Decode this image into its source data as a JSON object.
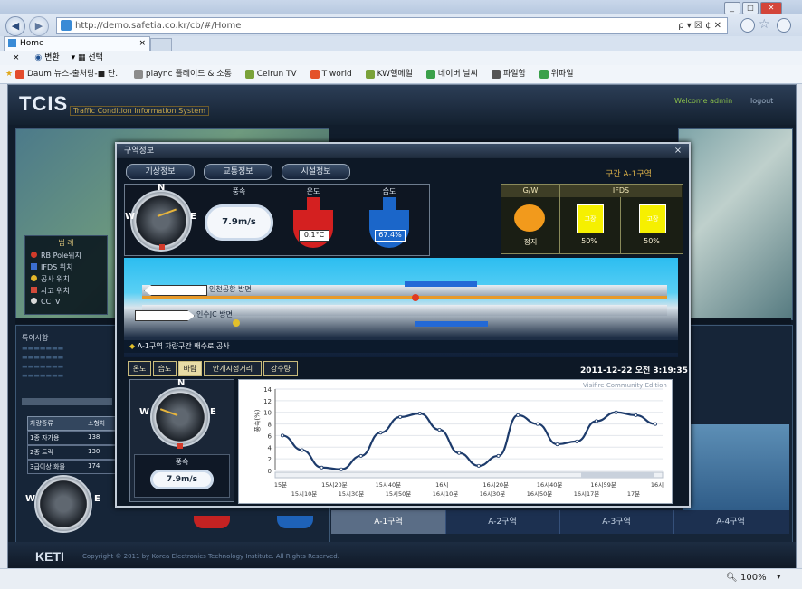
{
  "browser": {
    "url": "http://demo.safetia.co.kr/cb/#/Home",
    "search_hint": "ρ ▾ ☒ ¢ ✕",
    "tab_label": "Home",
    "cmd_items": [
      "×",
      "변환",
      "선택"
    ],
    "favorites": [
      "Daum 뉴스-출처랑-■ 단..",
      "plaync 플레이드 & 소통",
      "Celrun TV",
      "T world",
      "KW헬메일",
      "네이버 날씨",
      "파일함",
      "위파일"
    ],
    "zoom": "100%"
  },
  "app": {
    "logo": "TCIS",
    "logo_sub": "Traffic Condition Information System",
    "welcome": "Welcome admin",
    "logout": "logout",
    "legend_title": "범 례",
    "legend_items": [
      "RB Pole위치",
      "IFDS 위치",
      "공사 위치",
      "사고 위치",
      "CCTV"
    ],
    "legend_colors": [
      "#d03b2a",
      "#3c6fd0",
      "#e2b62a",
      "#d04a3a",
      "#d8d8d8"
    ],
    "lower_left_title": "특이사항",
    "table_header": [
      "차량종류",
      "소형차"
    ],
    "table_rows": [
      [
        "1종 자가용",
        "138"
      ],
      [
        "2종 트럭",
        "130"
      ],
      [
        "3급이상 화물",
        "174"
      ]
    ],
    "zones": [
      "A-1구역",
      "A-2구역",
      "A-3구역",
      "A-4구역"
    ],
    "footer_logo": "KETI",
    "copyright": "Copyright © 2011 by Korea Electronics Technology Institute. All Rights Reserved."
  },
  "modal": {
    "title": "구역정보",
    "close": "×",
    "tabs": [
      "기상정보",
      "교통정보",
      "시설정보"
    ],
    "section": "구간 A-1구역",
    "compass": {
      "n": "N",
      "w": "W",
      "e": "E"
    },
    "wind_label": "풍속",
    "wind_value": "7.9m/s",
    "temp_label": "온도",
    "temp_value": "0.1°C",
    "humid_label": "습도",
    "humid_value": "67.4%",
    "gw_header": "G/W",
    "ifds_header": "IFDS",
    "gw_status": "정지",
    "ifds1": "50%",
    "ifds2": "50%",
    "ifds_label1": "고장",
    "ifds_label2": "고장",
    "lane_top": "인천공항 방면",
    "lane_bottom": "인수JC 방면",
    "notice": "A-1구역 차량구간 배수로 공사",
    "sub_tabs": [
      "온도",
      "습도",
      "바람",
      "안개시정거리",
      "강수량"
    ],
    "datetime": "2011-12-22 오전 3:19:35",
    "small_wind_label": "풍속",
    "small_wind_value": "7.9m/s",
    "chart_watermark": "Visifire Community Edition"
  },
  "chart_data": {
    "type": "line",
    "ylabel": "풍속(%)",
    "ylim": [
      0,
      14
    ],
    "yticks": [
      0,
      2,
      4,
      6,
      8,
      10,
      12,
      14
    ],
    "x_labels_top": [
      "15분",
      "15시20분",
      "15시40분",
      "16시",
      "16시20분",
      "16시40분",
      "16시59분",
      "16시"
    ],
    "x_labels_bottom": [
      "15시10분",
      "15시30분",
      "15시50분",
      "16시10분",
      "16시30분",
      "16시50분",
      "16시17분",
      "17분"
    ],
    "series": [
      {
        "values": [
          6,
          3.5,
          0.5,
          0.2,
          2.5,
          6.5,
          9.2,
          9.8,
          7,
          3,
          0.8,
          2.5,
          9.5,
          8,
          4.5,
          5,
          8.5,
          10,
          9.5,
          8
        ]
      }
    ],
    "line_color": "#1d3b6b"
  }
}
